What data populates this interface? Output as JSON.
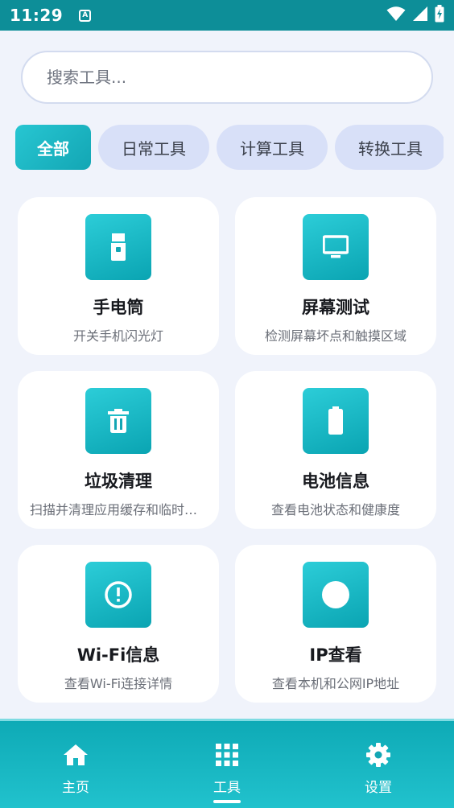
{
  "status_bar": {
    "time": "11:29",
    "notification_icon": "a-icon",
    "icons": [
      "wifi-icon",
      "signal-icon",
      "battery-charging-icon"
    ]
  },
  "search": {
    "placeholder": "搜索工具...",
    "value": ""
  },
  "categories": [
    {
      "label": "全部",
      "selected": true
    },
    {
      "label": "日常工具",
      "selected": false
    },
    {
      "label": "计算工具",
      "selected": false
    },
    {
      "label": "转换工具",
      "selected": false
    }
  ],
  "tools": [
    {
      "title": "手电筒",
      "description": "开关手机闪光灯",
      "icon": "flashlight-icon"
    },
    {
      "title": "屏幕测试",
      "description": "检测屏幕坏点和触摸区域",
      "icon": "monitor-icon"
    },
    {
      "title": "垃圾清理",
      "description": "扫描并清理应用缓存和临时文件",
      "icon": "trash-icon"
    },
    {
      "title": "电池信息",
      "description": "查看电池状态和健康度",
      "icon": "battery-icon"
    },
    {
      "title": "Wi-Fi信息",
      "description": "查看Wi-Fi连接详情",
      "icon": "alert-circle-icon"
    },
    {
      "title": "IP查看",
      "description": "查看本机和公网IP地址",
      "icon": "circle-icon"
    }
  ],
  "bottom_nav": [
    {
      "label": "主页",
      "icon": "home-icon",
      "active": false
    },
    {
      "label": "工具",
      "icon": "grid-icon",
      "active": true
    },
    {
      "label": "设置",
      "icon": "gear-icon",
      "active": false
    }
  ],
  "colors": {
    "accent": "#13a6b4",
    "status_bar": "#0d8e98",
    "background": "#f0f3fb",
    "chip_inactive": "#d8e0f8"
  }
}
